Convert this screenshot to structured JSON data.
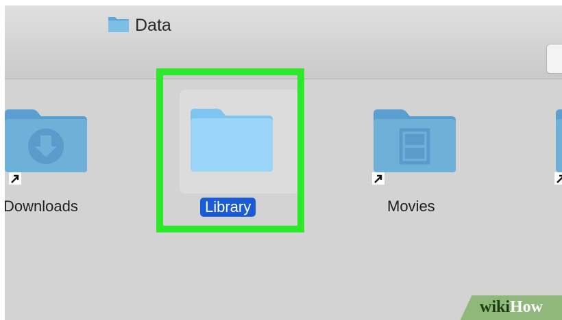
{
  "window": {
    "title": "Data"
  },
  "items": [
    {
      "name": "Downloads",
      "icon": "downloads-folder-icon",
      "alias": true,
      "selected": false
    },
    {
      "name": "Library",
      "icon": "folder-icon",
      "alias": false,
      "selected": true
    },
    {
      "name": "Movies",
      "icon": "movies-folder-icon",
      "alias": true,
      "selected": false
    }
  ],
  "watermark": {
    "part1": "wiki",
    "part2": "How"
  },
  "colors": {
    "highlight": "#2ee82e",
    "selection": "#1b5bd4",
    "folder": "#6fb0d9"
  }
}
